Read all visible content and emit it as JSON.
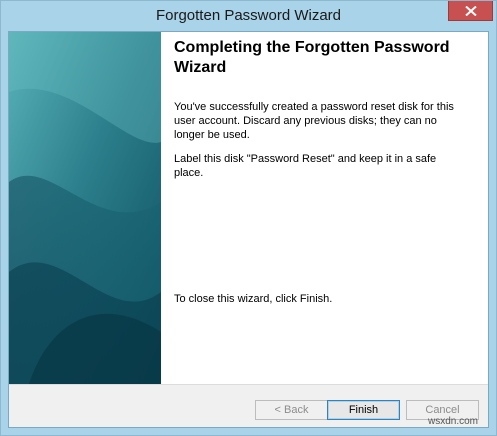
{
  "window": {
    "title": "Forgotten Password Wizard"
  },
  "content": {
    "heading": "Completing the Forgotten Password Wizard",
    "paragraph1": "You've successfully created a password reset disk for this user account. Discard any previous disks; they can no longer be used.",
    "paragraph2": "Label this disk \"Password Reset\" and keep it in a safe place.",
    "paragraph3": "To close this wizard, click Finish."
  },
  "buttons": {
    "back_label": "< Back",
    "finish_label": "Finish",
    "cancel_label": "Cancel",
    "back_enabled": false,
    "cancel_enabled": false
  },
  "watermark": "wsxdn.com",
  "icons": {
    "close": "close-icon"
  },
  "colors": {
    "titlebar": "#a9d3e8",
    "sidebar_dark": "#0f5a6e",
    "sidebar_light": "#3e99a6",
    "close_button": "#c75050"
  }
}
